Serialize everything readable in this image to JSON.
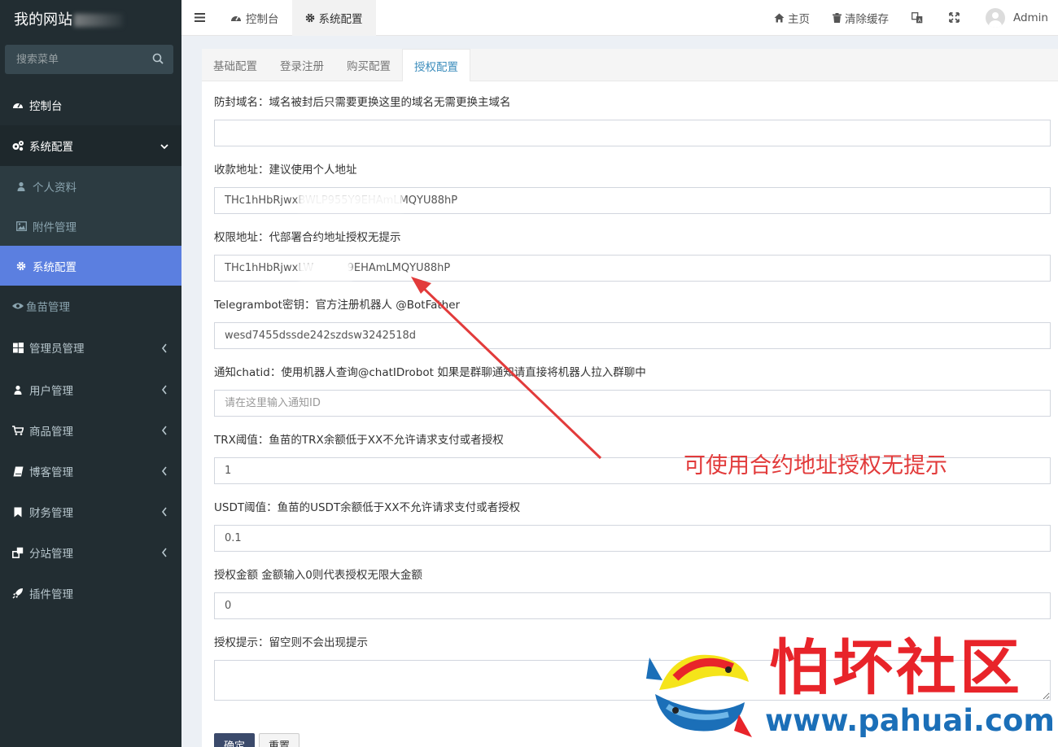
{
  "sidebar": {
    "logo": "我的网站",
    "search_placeholder": "搜索菜单",
    "items": [
      {
        "label": "控制台",
        "icon": "dashboard-icon"
      },
      {
        "label": "系统配置",
        "icon": "cogs-icon"
      },
      {
        "label": "管理员管理",
        "icon": "windows-icon"
      },
      {
        "label": "用户管理",
        "icon": "user-icon"
      },
      {
        "label": "商品管理",
        "icon": "cart-icon"
      },
      {
        "label": "博客管理",
        "icon": "book-icon"
      },
      {
        "label": "财务管理",
        "icon": "bookmark-icon"
      },
      {
        "label": "分站管理",
        "icon": "clone-icon"
      },
      {
        "label": "插件管理",
        "icon": "rocket-icon"
      }
    ],
    "sub_items": [
      {
        "label": "个人资料",
        "icon": "user-icon"
      },
      {
        "label": "附件管理",
        "icon": "image-icon"
      },
      {
        "label": "系统配置",
        "icon": "gear-icon"
      },
      {
        "label": "鱼苗管理",
        "icon": "eye-icon"
      }
    ]
  },
  "header": {
    "tabs": [
      {
        "label": "控制台",
        "icon": "dashboard-icon"
      },
      {
        "label": "系统配置",
        "icon": "gear-icon"
      }
    ],
    "links": {
      "home": "主页",
      "clear_cache": "清除缓存"
    },
    "user": "Admin"
  },
  "content": {
    "tabs": [
      "基础配置",
      "登录注册",
      "购买配置",
      "授权配置"
    ],
    "active_tab": "授权配置",
    "fields": [
      {
        "label": "防封域名：域名被封后只需要更换这里的域名无需更换主域名",
        "value": "",
        "placeholder": ""
      },
      {
        "label": "收款地址：建议使用个人地址",
        "value": "THc1hHbRjwxBWLP955Y9EHAmLMQYU88hP",
        "placeholder": ""
      },
      {
        "label": "权限地址：代部署合约地址授权无提示",
        "value": "THc1hHbRjwxLW          9EHAmLMQYU88hP",
        "placeholder": ""
      },
      {
        "label": "Telegrambot密钥：官方注册机器人 @BotFather",
        "value": "wesd7455dssde242szdsw3242518d",
        "placeholder": ""
      },
      {
        "label": "通知chatid：使用机器人查询@chatIDrobot 如果是群聊通知请直接将机器人拉入群聊中",
        "value": "",
        "placeholder": "请在这里输入通知ID"
      },
      {
        "label": "TRX阈值：鱼苗的TRX余额低于XX不允许请求支付或者授权",
        "value": "1",
        "placeholder": ""
      },
      {
        "label": "USDT阈值：鱼苗的USDT余额低于XX不允许请求支付或者授权",
        "value": "0.1",
        "placeholder": ""
      },
      {
        "label": "授权金额 金额输入0则代表授权无限大金额",
        "value": "0",
        "placeholder": ""
      }
    ],
    "textarea_label": "授权提示：留空则不会出现提示",
    "buttons": {
      "submit": "确定",
      "reset": "重置"
    }
  },
  "annotation": "可使用合约地址授权无提示",
  "watermark": {
    "title": "怕坏社区",
    "url": "www.pahuai.com"
  },
  "colors": {
    "sidebar_bg": "#222d32",
    "active_item": "#5b7fe0",
    "accent": "#3c8dbc",
    "annotation_red": "#e23b3b"
  }
}
